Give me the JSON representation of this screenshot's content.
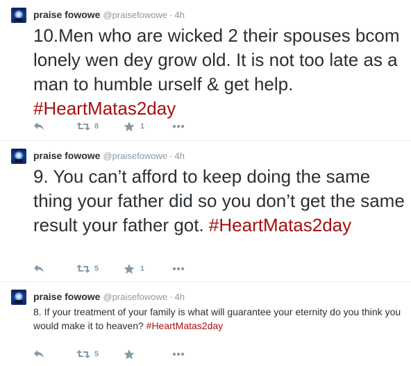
{
  "tweets": [
    {
      "name": "praise fowowe",
      "handle": "@praisefowowe",
      "separator": "·",
      "time": "4h",
      "text": "10.Men who are wicked 2 their spouses bcom lonely wen dey grow old. It is not too late as a man to humble urself & get help. ",
      "hashtag": "#HeartMatas2day",
      "retweets": "8",
      "favorites": "1"
    },
    {
      "name": "praise fowowe",
      "handle": "@praisefowowe",
      "separator": "·",
      "time": "4h",
      "text": "9. You can’t afford to keep doing the same thing your father did so you don’t get the same result your father got. ",
      "hashtag": "#HeartMatas2day",
      "retweets": "5",
      "favorites": "1"
    },
    {
      "name": "praise fowowe",
      "handle": "@praisefowowe",
      "separator": "·",
      "time": "4h",
      "text": "8. If your treatment of your family is what will guarantee your eternity do you think you would make it to heaven? ",
      "hashtag": "#HeartMatas2day",
      "retweets": "5",
      "favorites": ""
    }
  ],
  "icons": {
    "reply": "reply-icon",
    "retweet": "retweet-icon",
    "favorite": "star-icon",
    "more": "more-dots-icon"
  },
  "colors": {
    "hashtag": "#a50f0f",
    "muted": "#8899a6",
    "text": "#292f33",
    "divider": "#e8edef"
  }
}
